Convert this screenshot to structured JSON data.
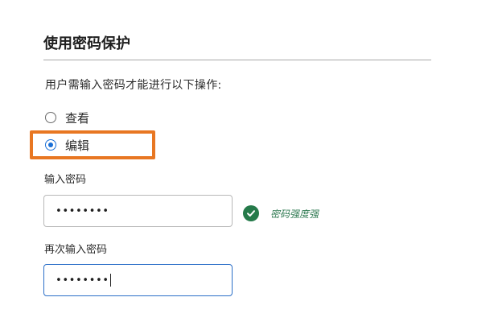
{
  "section": {
    "title": "使用密码保护",
    "instruction": "用户需输入密码才能进行以下操作:"
  },
  "permissions": {
    "options": [
      {
        "label": "查看",
        "selected": false
      },
      {
        "label": "编辑",
        "selected": true
      }
    ]
  },
  "password": {
    "label": "输入密码",
    "masked_value": "••••••••",
    "strength_text": "密码强度强"
  },
  "confirm_password": {
    "label": "再次输入密码",
    "masked_value": "••••••••"
  },
  "colors": {
    "highlight_border": "#e87722",
    "radio_selected": "#1a6fd6",
    "strength_ok": "#257a4a",
    "focus_border": "#2b6fc8"
  },
  "icons": {
    "strength_indicator": "check-circle-icon"
  }
}
